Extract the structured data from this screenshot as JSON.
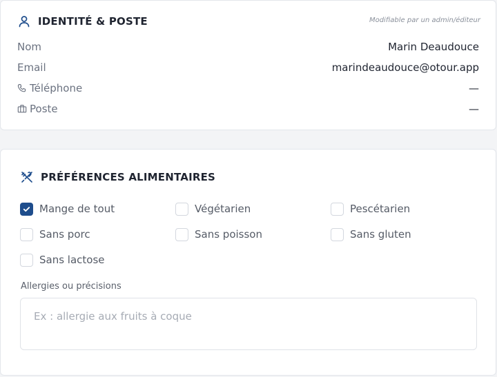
{
  "identity": {
    "title": "IDENTITÉ & POSTE",
    "icon": "user-icon",
    "edit_note": "Modifiable par un admin/éditeur",
    "fields": [
      {
        "label": "Nom",
        "value": "Marin Deaudouce",
        "icon": ""
      },
      {
        "label": "Email",
        "value": "marindeaudouce@otour.app",
        "icon": ""
      },
      {
        "label": "Téléphone",
        "value": "—",
        "icon": "phone-icon"
      },
      {
        "label": "Poste",
        "value": "—",
        "icon": "briefcase-icon"
      }
    ]
  },
  "diet": {
    "title": "PRÉFÉRENCES ALIMENTAIRES",
    "icon": "utensils-icon",
    "options": [
      {
        "label": "Mange de tout",
        "checked": true
      },
      {
        "label": "Végétarien",
        "checked": false
      },
      {
        "label": "Pescétarien",
        "checked": false
      },
      {
        "label": "Sans porc",
        "checked": false
      },
      {
        "label": "Sans poisson",
        "checked": false
      },
      {
        "label": "Sans gluten",
        "checked": false
      },
      {
        "label": "Sans lactose",
        "checked": false
      }
    ],
    "allergies_label": "Allergies ou précisions",
    "allergies_placeholder": "Ex : allergie aux fruits à coque",
    "allergies_value": ""
  },
  "colors": {
    "accent": "#1e4d8c",
    "text": "#1f2430",
    "muted": "#6b7280",
    "border": "#e3e6eb"
  }
}
